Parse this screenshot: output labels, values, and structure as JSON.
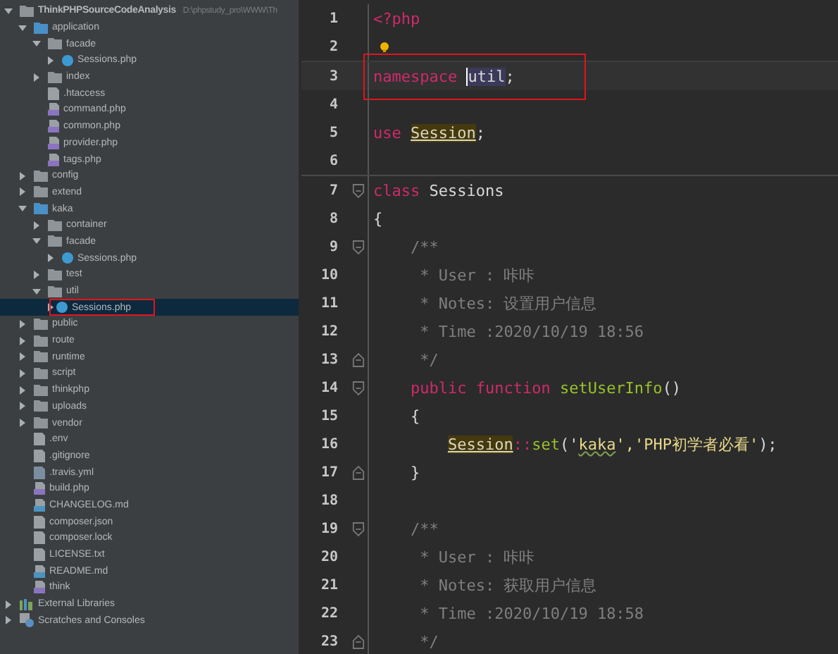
{
  "project_tree": {
    "items": [
      {
        "label": "ThinkPHPSourceCodeAnalysis",
        "path": "D:\\phpstudy_pro\\WWW\\Th",
        "kind": "folder",
        "expanded": true,
        "selected": false,
        "children": [
          {
            "label": "application",
            "kind": "folder",
            "expanded": true,
            "selected": false,
            "children": [
              {
                "label": "facade",
                "kind": "folder",
                "expanded": true,
                "selected": false,
                "children": [
                  {
                    "label": "Sessions.php",
                    "kind": "class",
                    "expanded": false,
                    "selected": false
                  }
                ]
              },
              {
                "label": "index",
                "kind": "folder",
                "expanded": false,
                "selected": false
              },
              {
                "label": ".htaccess",
                "kind": "config",
                "selected": false
              },
              {
                "label": "command.php",
                "kind": "php",
                "selected": false
              },
              {
                "label": "common.php",
                "kind": "php",
                "selected": false
              },
              {
                "label": "provider.php",
                "kind": "php",
                "selected": false
              },
              {
                "label": "tags.php",
                "kind": "php",
                "selected": false
              }
            ]
          },
          {
            "label": "config",
            "kind": "folder",
            "expanded": false,
            "selected": false
          },
          {
            "label": "extend",
            "kind": "folder",
            "expanded": false,
            "selected": false
          },
          {
            "label": "kaka",
            "kind": "folder",
            "expanded": true,
            "selected": false,
            "children": [
              {
                "label": "container",
                "kind": "folder",
                "expanded": false,
                "selected": false
              },
              {
                "label": "facade",
                "kind": "folder",
                "expanded": true,
                "selected": false,
                "children": [
                  {
                    "label": "Sessions.php",
                    "kind": "class",
                    "expanded": false,
                    "selected": false
                  }
                ]
              },
              {
                "label": "test",
                "kind": "folder",
                "expanded": false,
                "selected": false
              },
              {
                "label": "util",
                "kind": "folder",
                "expanded": true,
                "selected": false,
                "children": [
                  {
                    "label": "Sessions.php",
                    "kind": "class",
                    "expanded": false,
                    "selected": true
                  }
                ]
              }
            ]
          },
          {
            "label": "public",
            "kind": "folder",
            "expanded": false,
            "selected": false
          },
          {
            "label": "route",
            "kind": "folder",
            "expanded": false,
            "selected": false
          },
          {
            "label": "runtime",
            "kind": "folder",
            "expanded": false,
            "selected": false
          },
          {
            "label": "script",
            "kind": "folder",
            "expanded": false,
            "selected": false
          },
          {
            "label": "thinkphp",
            "kind": "folder",
            "expanded": false,
            "selected": false
          },
          {
            "label": "uploads",
            "kind": "folder",
            "expanded": false,
            "selected": false
          },
          {
            "label": "vendor",
            "kind": "folder",
            "expanded": false,
            "selected": false
          },
          {
            "label": ".env",
            "kind": "text",
            "selected": false
          },
          {
            "label": ".gitignore",
            "kind": "text",
            "selected": false
          },
          {
            "label": ".travis.yml",
            "kind": "yaml",
            "selected": false
          },
          {
            "label": "build.php",
            "kind": "php",
            "selected": false
          },
          {
            "label": "CHANGELOG.md",
            "kind": "markdown",
            "selected": false
          },
          {
            "label": "composer.json",
            "kind": "config",
            "selected": false
          },
          {
            "label": "composer.lock",
            "kind": "config",
            "selected": false
          },
          {
            "label": "LICENSE.txt",
            "kind": "text",
            "selected": false
          },
          {
            "label": "README.md",
            "kind": "markdown",
            "selected": false
          },
          {
            "label": "think",
            "kind": "php",
            "selected": false
          }
        ]
      },
      {
        "label": "External Libraries",
        "kind": "library",
        "expanded": false,
        "selected": false
      },
      {
        "label": "Scratches and Consoles",
        "kind": "scratches",
        "expanded": false,
        "selected": false
      }
    ]
  },
  "editor": {
    "lines": [
      {
        "number": "1",
        "tokens": [
          {
            "text": "<?php",
            "kind": "tag"
          }
        ]
      },
      {
        "number": "2",
        "bulb": true
      },
      {
        "number": "3",
        "current": true,
        "boxed": true,
        "tokens": [
          {
            "text": "namespace ",
            "kind": "keyword"
          },
          {
            "text": "util",
            "kind": "selection"
          },
          {
            "text": ";",
            "kind": "plain"
          }
        ]
      },
      {
        "number": "4"
      },
      {
        "number": "5",
        "tokens": [
          {
            "text": "use ",
            "kind": "keyword"
          },
          {
            "text": "Session",
            "kind": "ref"
          },
          {
            "text": ";",
            "kind": "plain"
          }
        ]
      },
      {
        "number": "6",
        "separator": true
      },
      {
        "number": "7",
        "fold_start": true,
        "tokens": [
          {
            "text": "class ",
            "kind": "keyword"
          },
          {
            "text": "Sessions",
            "kind": "plain"
          }
        ]
      },
      {
        "number": "8",
        "tokens": [
          {
            "text": "{",
            "kind": "plain"
          }
        ]
      },
      {
        "number": "9",
        "fold_start": true,
        "tokens": [
          {
            "text": "    /**",
            "kind": "comment"
          }
        ]
      },
      {
        "number": "10",
        "tokens": [
          {
            "text": "     * User : 咔咔",
            "kind": "comment"
          }
        ]
      },
      {
        "number": "11",
        "tokens": [
          {
            "text": "     * Notes: 设置用户信息",
            "kind": "comment"
          }
        ]
      },
      {
        "number": "12",
        "tokens": [
          {
            "text": "     * Time :2020/10/19 18:56",
            "kind": "comment"
          }
        ]
      },
      {
        "number": "13",
        "fold_end": true,
        "tokens": [
          {
            "text": "     */",
            "kind": "comment"
          }
        ]
      },
      {
        "number": "14",
        "fold_start": true,
        "tokens": [
          {
            "text": "    public function ",
            "kind": "keyword"
          },
          {
            "text": "setUserInfo",
            "kind": "func"
          },
          {
            "text": "()",
            "kind": "plain"
          }
        ]
      },
      {
        "number": "15",
        "tokens": [
          {
            "text": "    {",
            "kind": "plain"
          }
        ]
      },
      {
        "number": "16",
        "indented": true,
        "tokens": [
          {
            "text": "Session",
            "kind": "ref"
          },
          {
            "text": "::",
            "kind": "keyword"
          },
          {
            "text": "set",
            "kind": "func"
          },
          {
            "text": "('",
            "kind": "plain"
          },
          {
            "text": "kaka",
            "kind": "typo"
          },
          {
            "text": "','PHP初学者必看'",
            "kind": "string"
          },
          {
            "text": ");",
            "kind": "plain"
          }
        ]
      },
      {
        "number": "17",
        "fold_end": true,
        "tokens": [
          {
            "text": "    }",
            "kind": "plain"
          }
        ]
      },
      {
        "number": "18"
      },
      {
        "number": "19",
        "fold_start": true,
        "tokens": [
          {
            "text": "    /**",
            "kind": "comment"
          }
        ]
      },
      {
        "number": "20",
        "tokens": [
          {
            "text": "     * User : 咔咔",
            "kind": "comment"
          }
        ]
      },
      {
        "number": "21",
        "tokens": [
          {
            "text": "     * Notes: 获取用户信息",
            "kind": "comment"
          }
        ]
      },
      {
        "number": "22",
        "tokens": [
          {
            "text": "     * Time :2020/10/19 18:58",
            "kind": "comment"
          }
        ]
      },
      {
        "number": "23",
        "fold_end": true,
        "tokens": [
          {
            "text": "     */",
            "kind": "comment"
          }
        ]
      }
    ]
  }
}
